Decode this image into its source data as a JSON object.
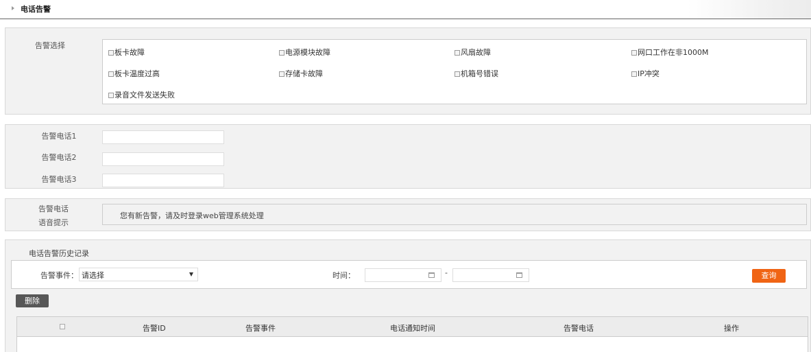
{
  "header": {
    "title": "电话告警"
  },
  "alarm_selection": {
    "label": "告警选择",
    "options": [
      "板卡故障",
      "电源模块故障",
      "风扇故障",
      "网口工作在非1000M",
      "板卡温度过高",
      "存储卡故障",
      "机箱号错误",
      "IP冲突",
      "录音文件发送失败"
    ]
  },
  "phones": {
    "labels": [
      "告警电话1",
      "告警电话2",
      "告警电话3"
    ],
    "values": [
      "",
      "",
      ""
    ]
  },
  "voice": {
    "label_line1": "告警电话",
    "label_line2": "语音提示",
    "message": "您有新告警，请及时登录web管理系统处理"
  },
  "history": {
    "title": "电话告警历史记录",
    "event_label": "告警事件：",
    "event_select": "请选择",
    "time_label": "时间：",
    "date_separator": "-",
    "query_button": "查询",
    "delete_button": "删除",
    "columns": [
      "告警ID",
      "告警事件",
      "电话通知时间",
      "告警电话",
      "操作"
    ]
  },
  "colors": {
    "accent": "#f06414",
    "delete_button": "#575757",
    "panel_bg": "#f2f2f2"
  }
}
